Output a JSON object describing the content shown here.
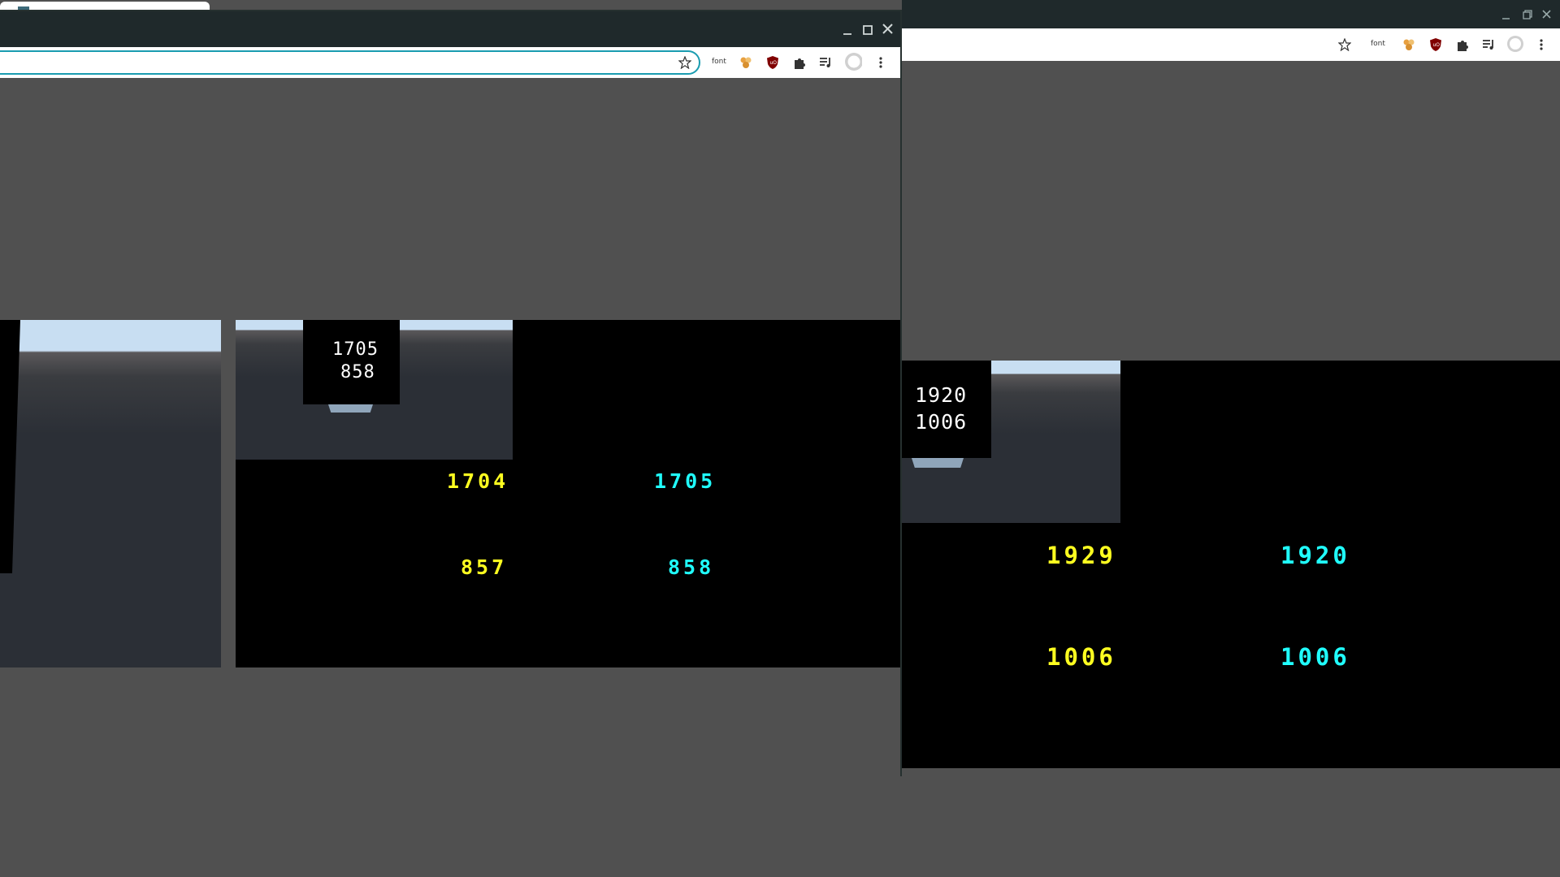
{
  "right_window": {
    "toolbar": {
      "font_label": "font"
    },
    "overlay": {
      "width": "1920",
      "height": "1006"
    },
    "readouts": {
      "yellow_width": "1929",
      "yellow_height": "1006",
      "cyan_width": "1920",
      "cyan_height": "1006"
    }
  },
  "left_window": {
    "toolbar": {
      "font_label": "font"
    },
    "overlay": {
      "width": "1705",
      "height": "858"
    },
    "readouts": {
      "yellow_width": "1704",
      "yellow_height": "857",
      "cyan_width": "1705",
      "cyan_height": "858"
    }
  },
  "colors": {
    "desktop": "#505050",
    "titlebar": "#202a2c",
    "address_focus": "#1a9cb0",
    "readout_yellow": "#ffff20",
    "readout_cyan": "#20ffff",
    "ublock_red": "#800000"
  }
}
